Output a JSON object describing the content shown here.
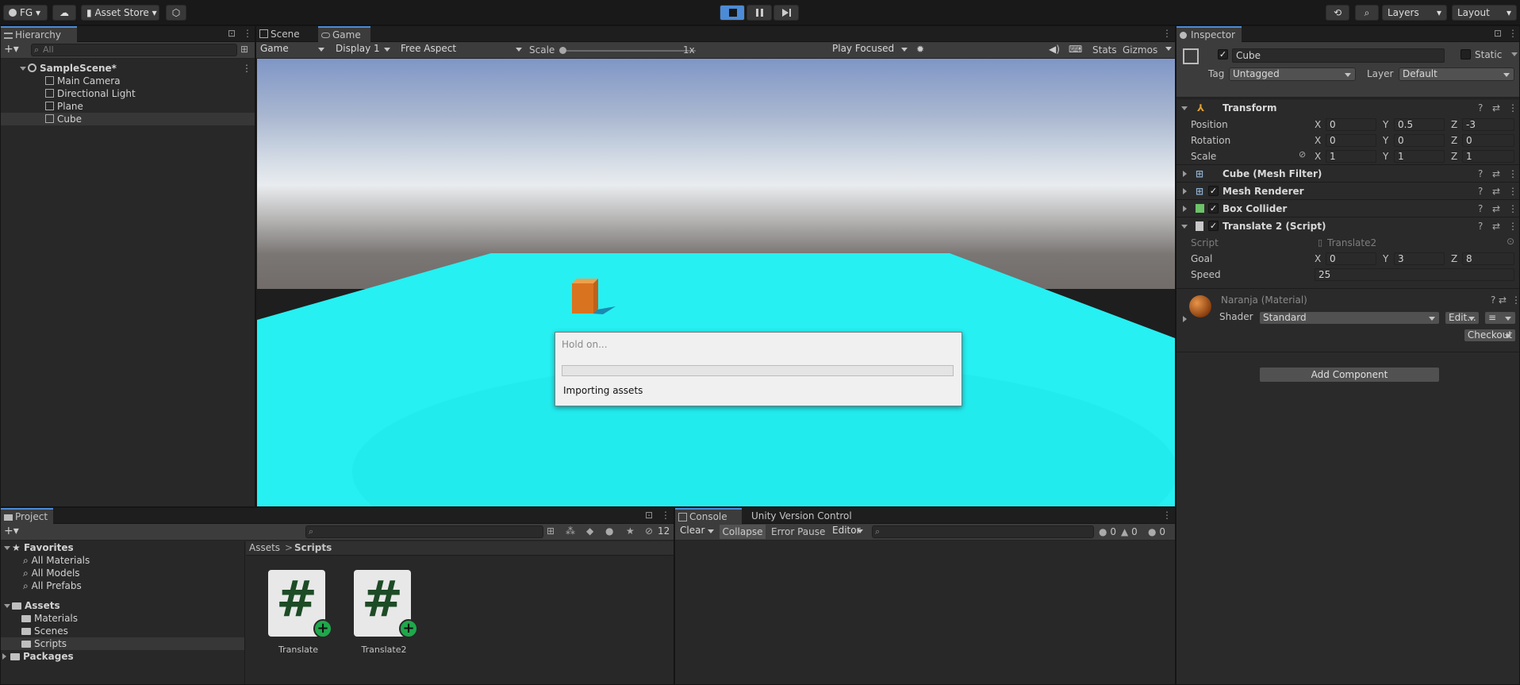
{
  "toolbar": {
    "account": "FG",
    "asset_store": "Asset Store",
    "layers": "Layers",
    "layout": "Layout"
  },
  "hierarchy": {
    "tab": "Hierarchy",
    "search_placeholder": "All",
    "scene": "SampleScene*",
    "items": [
      "Main Camera",
      "Directional Light",
      "Plane",
      "Cube"
    ]
  },
  "game": {
    "tabs": [
      "Scene",
      "Game"
    ],
    "game_dropdown": "Game",
    "display": "Display 1",
    "aspect": "Free Aspect",
    "scale_label": "Scale",
    "scale_value": "1x",
    "play_mode": "Play Focused",
    "stats": "Stats",
    "gizmos": "Gizmos",
    "sky_top": "#7f96c6",
    "floor": "#26f0f2"
  },
  "dialog": {
    "title": "Hold on...",
    "progress": 0,
    "message": "Importing assets"
  },
  "inspector": {
    "tab": "Inspector",
    "object_name": "Cube",
    "static_label": "Static",
    "tag_label": "Tag",
    "tag_value": "Untagged",
    "layer_label": "Layer",
    "layer_value": "Default",
    "transform": {
      "title": "Transform",
      "rows": [
        {
          "label": "Position",
          "x": "0",
          "y": "0.5",
          "z": "-3"
        },
        {
          "label": "Rotation",
          "x": "0",
          "y": "0",
          "z": "0"
        },
        {
          "label": "Scale",
          "x": "1",
          "y": "1",
          "z": "1"
        }
      ]
    },
    "components": [
      "Cube (Mesh Filter)",
      "Mesh Renderer",
      "Box Collider",
      "Translate 2 (Script)"
    ],
    "script": {
      "script_label": "Script",
      "script_value": "Translate2",
      "goal_label": "Goal",
      "goal": {
        "x": "0",
        "y": "3",
        "z": "8"
      },
      "speed_label": "Speed",
      "speed_value": "25"
    },
    "material": {
      "name": "Naranja (Material)",
      "shader_label": "Shader",
      "shader_value": "Standard",
      "edit": "Edit...",
      "checkout": "Checkout"
    },
    "add_component": "Add Component"
  },
  "project": {
    "tab": "Project",
    "favorites_label": "Favorites",
    "favorites": [
      "All Materials",
      "All Models",
      "All Prefabs"
    ],
    "assets_label": "Assets",
    "assets": [
      "Materials",
      "Scenes",
      "Scripts"
    ],
    "packages": "Packages",
    "breadcrumb_root": "Assets",
    "breadcrumb_sep": ">",
    "breadcrumb_current": "Scripts",
    "hidden_count": "12",
    "files": [
      "Translate",
      "Translate2"
    ]
  },
  "console": {
    "tabs": [
      "Console",
      "Unity Version Control"
    ],
    "clear": "Clear",
    "collapse": "Collapse",
    "error_pause": "Error Pause",
    "editor": "Editor",
    "counts": [
      "0",
      "0",
      "0"
    ]
  }
}
